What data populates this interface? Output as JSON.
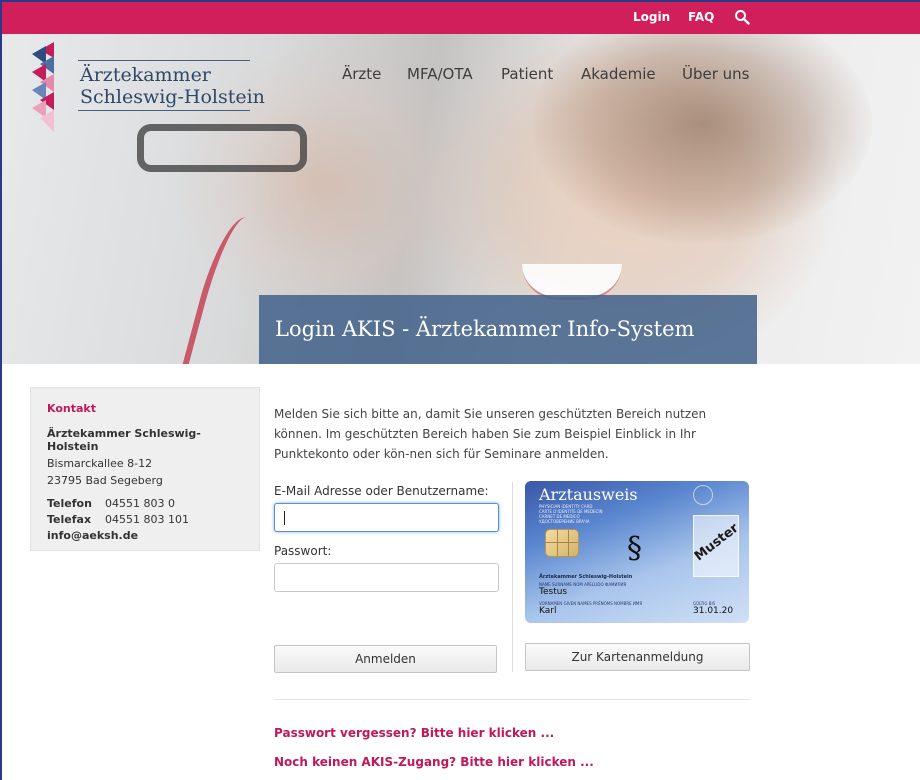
{
  "topbar": {
    "login_label": "Login",
    "faq_label": "FAQ",
    "accent_color": "#d11f5b"
  },
  "logo": {
    "line1": "Ärztekammer",
    "line2": "Schleswig-Holstein"
  },
  "nav": {
    "items": [
      "Ärzte",
      "MFA/OTA",
      "Patient",
      "Akademie",
      "Über uns"
    ]
  },
  "hero": {
    "title": "Login AKIS - Ärztekammer Info-System"
  },
  "sidebar": {
    "heading": "Kontakt",
    "org": "Ärztekammer Schleswig-Holstein",
    "street": "Bismarckallee 8-12",
    "city": "23795 Bad Segeberg",
    "phone_label": "Telefon",
    "phone": "04551 803 0",
    "fax_label": "Telefax",
    "fax": "04551 803 101",
    "email": "info@aeksh.de"
  },
  "main": {
    "intro": "Melden Sie sich bitte an, damit Sie unseren geschützten Bereich nutzen können. Im geschützten Bereich haben Sie zum Beispiel Einblick in Ihr Punktekonto oder kön-nen sich für Seminare anmelden.",
    "email_label": "E-Mail Adresse oder Benutzername:",
    "email_value": "",
    "password_label": "Passwort:",
    "password_value": "",
    "login_button": "Anmelden",
    "card_button": "Zur Kartenanmeldung",
    "forgot_link": "Passwort vergessen? Bitte hier klicken ...",
    "register_link": "Noch keinen AKIS-Zugang? Bitte hier klicken ..."
  },
  "card": {
    "title": "Arztausweis",
    "subtitle_lines": [
      "PHYSICIAN IDENTITY CARD",
      "CARTE D'IDENTITE DE MEDECIN",
      "CARNET DE MEDICO",
      "УДОСТОВЕРЕНИЕ ВРАЧА"
    ],
    "org": "Ärztekammer Schleswig-Holstein",
    "name_label": "NAME  SURNAME  NOM  APELLIDO  ФАМИЛИЯ",
    "surname": "Testus",
    "firstname_label": "VORNAMEN  GIVEN NAMES  PRÉNOMS  NOMBRE  ИМЯ",
    "firstname": "Karl",
    "valid_label": "GÜLTIG BIS",
    "valid_until": "31.01.20",
    "watermark": "Muster"
  }
}
